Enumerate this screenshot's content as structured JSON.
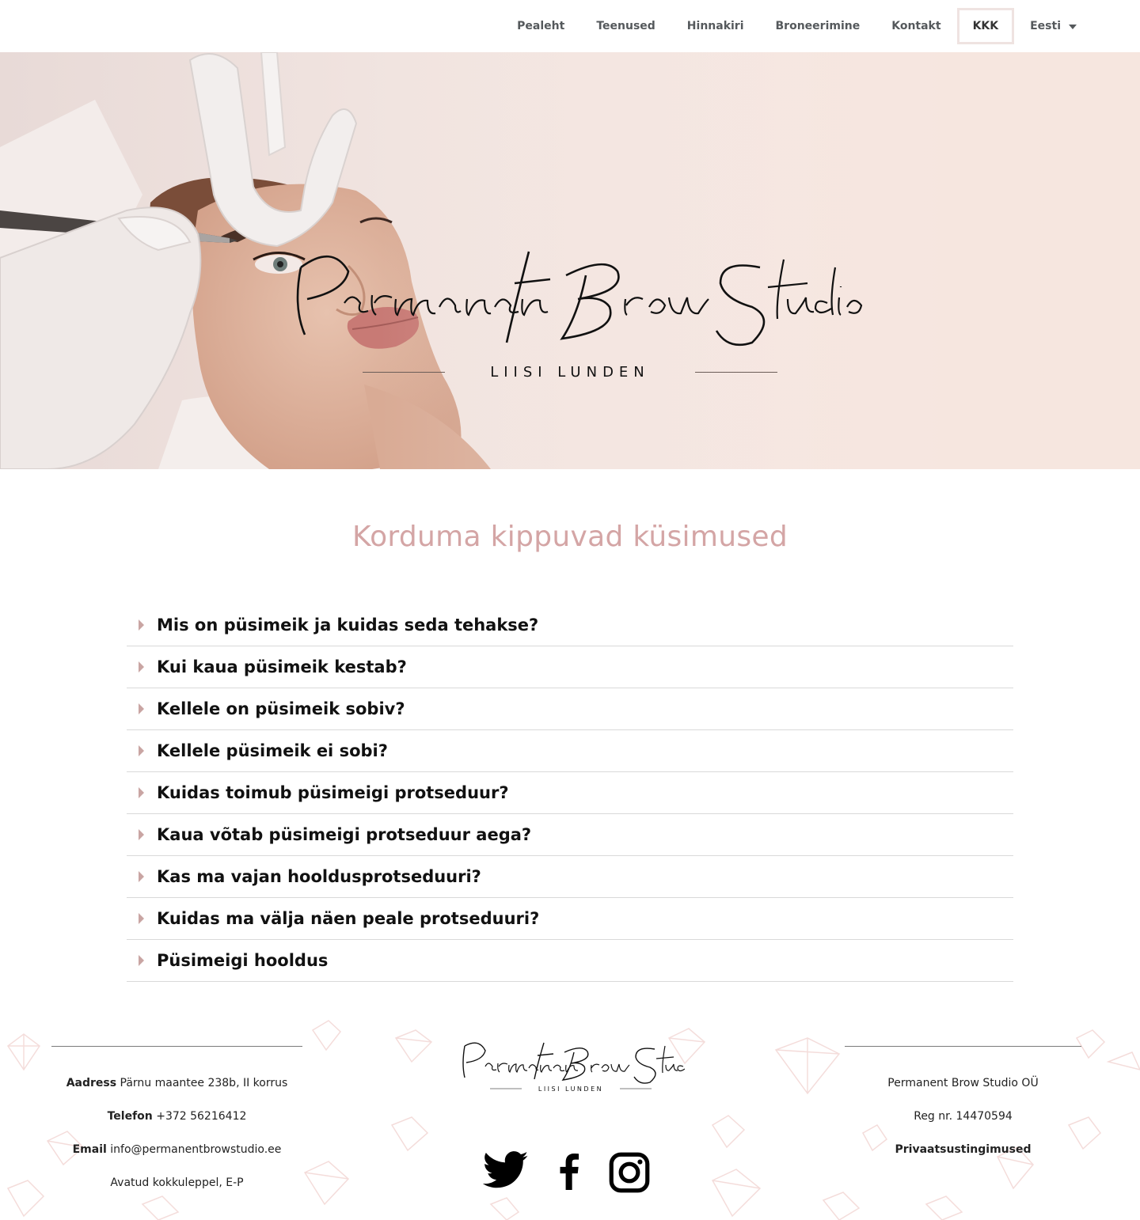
{
  "nav": {
    "items": [
      {
        "label": "Pealeht"
      },
      {
        "label": "Teenused"
      },
      {
        "label": "Hinnakiri"
      },
      {
        "label": "Broneerimine"
      },
      {
        "label": "Kontakt"
      },
      {
        "label": "KKK"
      },
      {
        "label": "Eesti"
      }
    ]
  },
  "hero": {
    "logo_script": "Permanent Brow Studio",
    "subtitle": "LIISI LUNDEN"
  },
  "faq": {
    "title": "Korduma kippuvad küsimused",
    "items": [
      "Mis on püsimeik ja kuidas seda tehakse?",
      "Kui kaua püsimeik kestab?",
      "Kellele on püsimeik sobiv?",
      "Kellele püsimeik ei sobi?",
      "Kuidas toimub püsimeigi protseduur?",
      "Kaua võtab püsimeigi protseduur aega?",
      "Kas ma vajan hooldusprotseduuri?",
      "Kuidas ma välja näen peale protseduuri?",
      "Püsimeigi hooldus"
    ],
    "arrow_color": "#c9a5a3",
    "title_color": "#d4a5a5"
  },
  "footer": {
    "contact": {
      "address_label": "Aadress",
      "address": "Pärnu maantee 238b, II korrus",
      "phone_label": "Telefon",
      "phone": "+372 56216412",
      "email_label": "Email",
      "email": "info@permanentbrowstudio.ee",
      "hours": "Avatud kokkuleppel, E-P"
    },
    "logo_script": "Permanent Brow Studio",
    "logo_sub": "LIISI LUNDEN",
    "company": "Permanent Brow Studio OÜ",
    "reg": "Reg nr. 14470594",
    "privacy": "Privaatsustingimused",
    "social_icons": [
      "twitter-icon",
      "facebook-icon",
      "instagram-icon"
    ]
  }
}
